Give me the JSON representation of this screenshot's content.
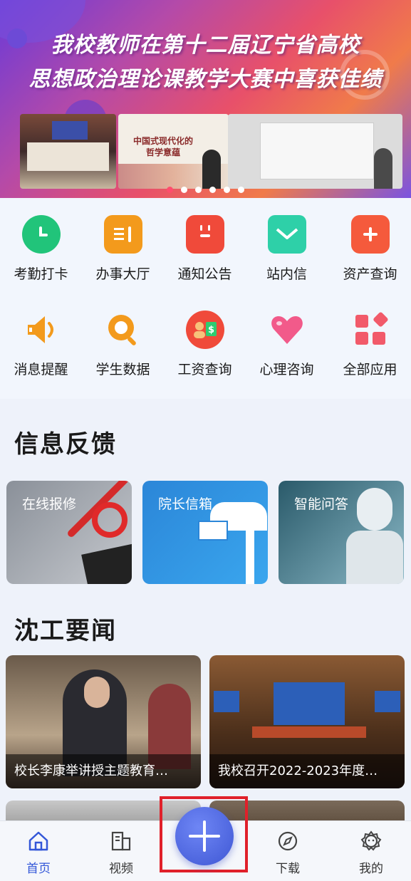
{
  "banner": {
    "title_line1": "我校教师在第十二届辽宁省高校",
    "title_line2": "思想政治理论课教学大赛中喜获佳绩",
    "slide_text": "中国式现代化的\n哲学意蕴",
    "active_dot": 0,
    "dot_count": 6
  },
  "apps": [
    {
      "label": "考勤打卡",
      "icon": "clock-icon",
      "color": "#21c47a"
    },
    {
      "label": "办事大厅",
      "icon": "document-icon",
      "color": "#f39a1c"
    },
    {
      "label": "通知公告",
      "icon": "calendar-icon",
      "color": "#f04a3a"
    },
    {
      "label": "站内信",
      "icon": "mail-icon",
      "color": "#2ed0a8"
    },
    {
      "label": "资产查询",
      "icon": "plus-icon",
      "color": "#f55a3c"
    },
    {
      "label": "消息提醒",
      "icon": "speaker-icon",
      "color": "#f39a1c"
    },
    {
      "label": "学生数据",
      "icon": "search-icon",
      "color": "#f39a1c"
    },
    {
      "label": "工资查询",
      "icon": "salary-icon",
      "color": "#f04a3a"
    },
    {
      "label": "心理咨询",
      "icon": "heart-icon",
      "color": "#f25a8a"
    },
    {
      "label": "全部应用",
      "icon": "apps-grid-icon",
      "color": "#f25a6a"
    }
  ],
  "feedback": {
    "title": "信息反馈",
    "cards": [
      {
        "label": "在线报修"
      },
      {
        "label": "院长信箱"
      },
      {
        "label": "智能问答"
      }
    ]
  },
  "news": {
    "title": "沈工要闻",
    "items": [
      {
        "caption": "校长李康举讲授主题教育…"
      },
      {
        "caption": "我校召开2022-2023年度…"
      }
    ]
  },
  "nav": {
    "items": [
      {
        "label": "首页",
        "icon": "home-icon",
        "active": true
      },
      {
        "label": "视频",
        "icon": "video-icon",
        "active": false
      },
      {
        "label": "下载",
        "icon": "compass-icon",
        "active": false
      },
      {
        "label": "我的",
        "icon": "user-icon",
        "active": false
      }
    ],
    "fab_icon": "add-icon"
  },
  "colors": {
    "accent": "#3357d8",
    "highlight_border": "#e0202a"
  }
}
